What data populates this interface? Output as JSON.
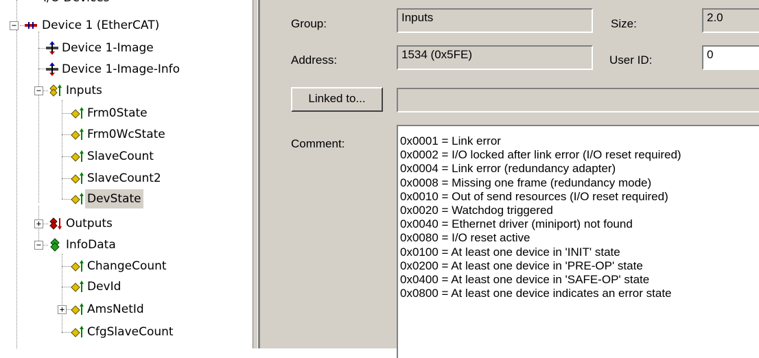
{
  "tree": {
    "top_partial": "I/O Devices",
    "items": [
      {
        "label": "Device 1 (EtherCAT)",
        "icon": "ethercat-device-icon",
        "expander": "minus"
      },
      {
        "label": "Device 1-Image",
        "icon": "process-image-icon"
      },
      {
        "label": "Device 1-Image-Info",
        "icon": "process-image-icon"
      },
      {
        "label": "Inputs",
        "icon": "inputs-group-icon",
        "expander": "minus"
      },
      {
        "label": "Frm0State",
        "icon": "input-variable-icon"
      },
      {
        "label": "Frm0WcState",
        "icon": "input-variable-icon"
      },
      {
        "label": "SlaveCount",
        "icon": "input-variable-icon"
      },
      {
        "label": "SlaveCount2",
        "icon": "input-variable-icon"
      },
      {
        "label": "DevState",
        "icon": "input-variable-icon",
        "selected": true
      },
      {
        "label": "Outputs",
        "icon": "outputs-group-icon",
        "expander": "plus"
      },
      {
        "label": "InfoData",
        "icon": "infodata-group-icon",
        "expander": "minus"
      },
      {
        "label": "ChangeCount",
        "icon": "input-variable-icon"
      },
      {
        "label": "DevId",
        "icon": "input-variable-icon"
      },
      {
        "label": "AmsNetId",
        "icon": "input-variable-icon",
        "expander": "plus"
      },
      {
        "label": "CfgSlaveCount",
        "icon": "input-variable-icon"
      }
    ]
  },
  "properties": {
    "group_label": "Group:",
    "group_value": "Inputs",
    "size_label": "Size:",
    "size_value": "2.0",
    "address_label": "Address:",
    "address_value": "1534 (0x5FE)",
    "userid_label": "User ID:",
    "userid_value": "0",
    "linked_button": "Linked to...",
    "linked_value": "",
    "comment_label": "Comment:",
    "comment_lines": [
      "0x0001 = Link error",
      "0x0002 = I/O locked after link error (I/O reset required)",
      "0x0004 = Link error (redundancy adapter)",
      "0x0008 = Missing one frame (redundancy mode)",
      "0x0010 = Out of send resources (I/O reset required)",
      "0x0020 = Watchdog triggered",
      "0x0040 = Ethernet driver (miniport) not found",
      "0x0080 = I/O reset active",
      "0x0100 = At least one device in 'INIT' state",
      "0x0200 = At least one device in 'PRE-OP' state",
      "0x0400 = At least one device in 'SAFE-OP' state",
      "0x0800 = At least one device indicates an error state"
    ]
  }
}
